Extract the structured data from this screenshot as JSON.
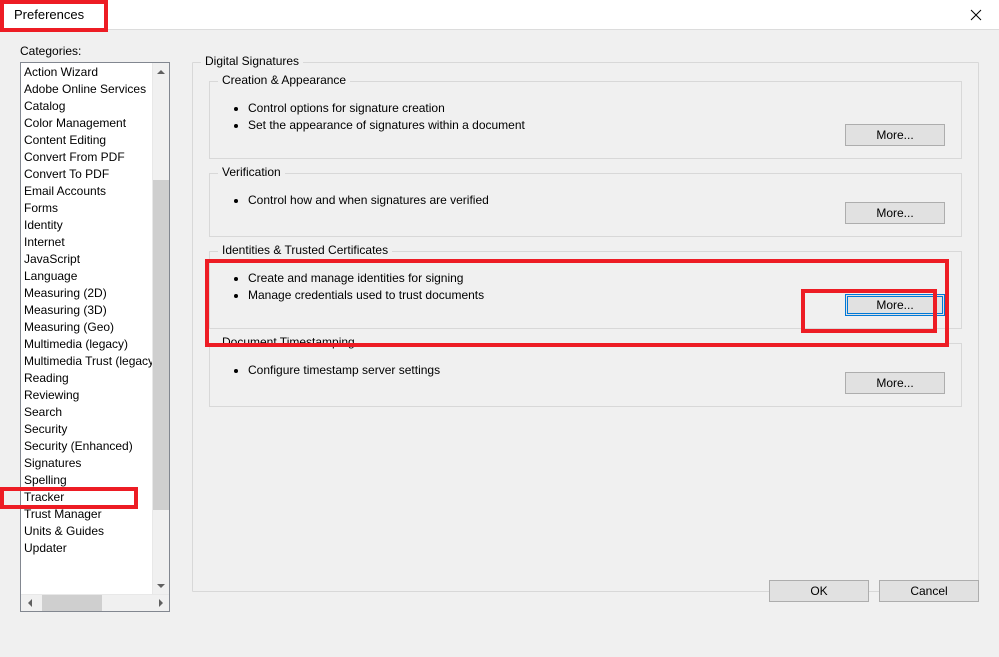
{
  "title": "Preferences",
  "categoriesLabel": "Categories:",
  "categories": [
    "Action Wizard",
    "Adobe Online Services",
    "Catalog",
    "Color Management",
    "Content Editing",
    "Convert From PDF",
    "Convert To PDF",
    "Email Accounts",
    "Forms",
    "Identity",
    "Internet",
    "JavaScript",
    "Language",
    "Measuring (2D)",
    "Measuring (3D)",
    "Measuring (Geo)",
    "Multimedia (legacy)",
    "Multimedia Trust (legacy)",
    "Reading",
    "Reviewing",
    "Search",
    "Security",
    "Security (Enhanced)",
    "Signatures",
    "Spelling",
    "Tracker",
    "Trust Manager",
    "Units & Guides",
    "Updater"
  ],
  "groupTitle": "Digital Signatures",
  "sections": {
    "creation": {
      "title": "Creation & Appearance",
      "bullets": [
        "Control options for signature creation",
        "Set the appearance of signatures within a document"
      ],
      "more": "More..."
    },
    "verification": {
      "title": "Verification",
      "bullets": [
        "Control how and when signatures are verified"
      ],
      "more": "More..."
    },
    "identities": {
      "title": "Identities & Trusted Certificates",
      "bullets": [
        "Create and manage identities for signing",
        "Manage credentials used to trust documents"
      ],
      "more": "More..."
    },
    "timestamp": {
      "title": "Document Timestamping",
      "bullets": [
        "Configure timestamp server settings"
      ],
      "more": "More..."
    }
  },
  "buttons": {
    "ok": "OK",
    "cancel": "Cancel"
  }
}
